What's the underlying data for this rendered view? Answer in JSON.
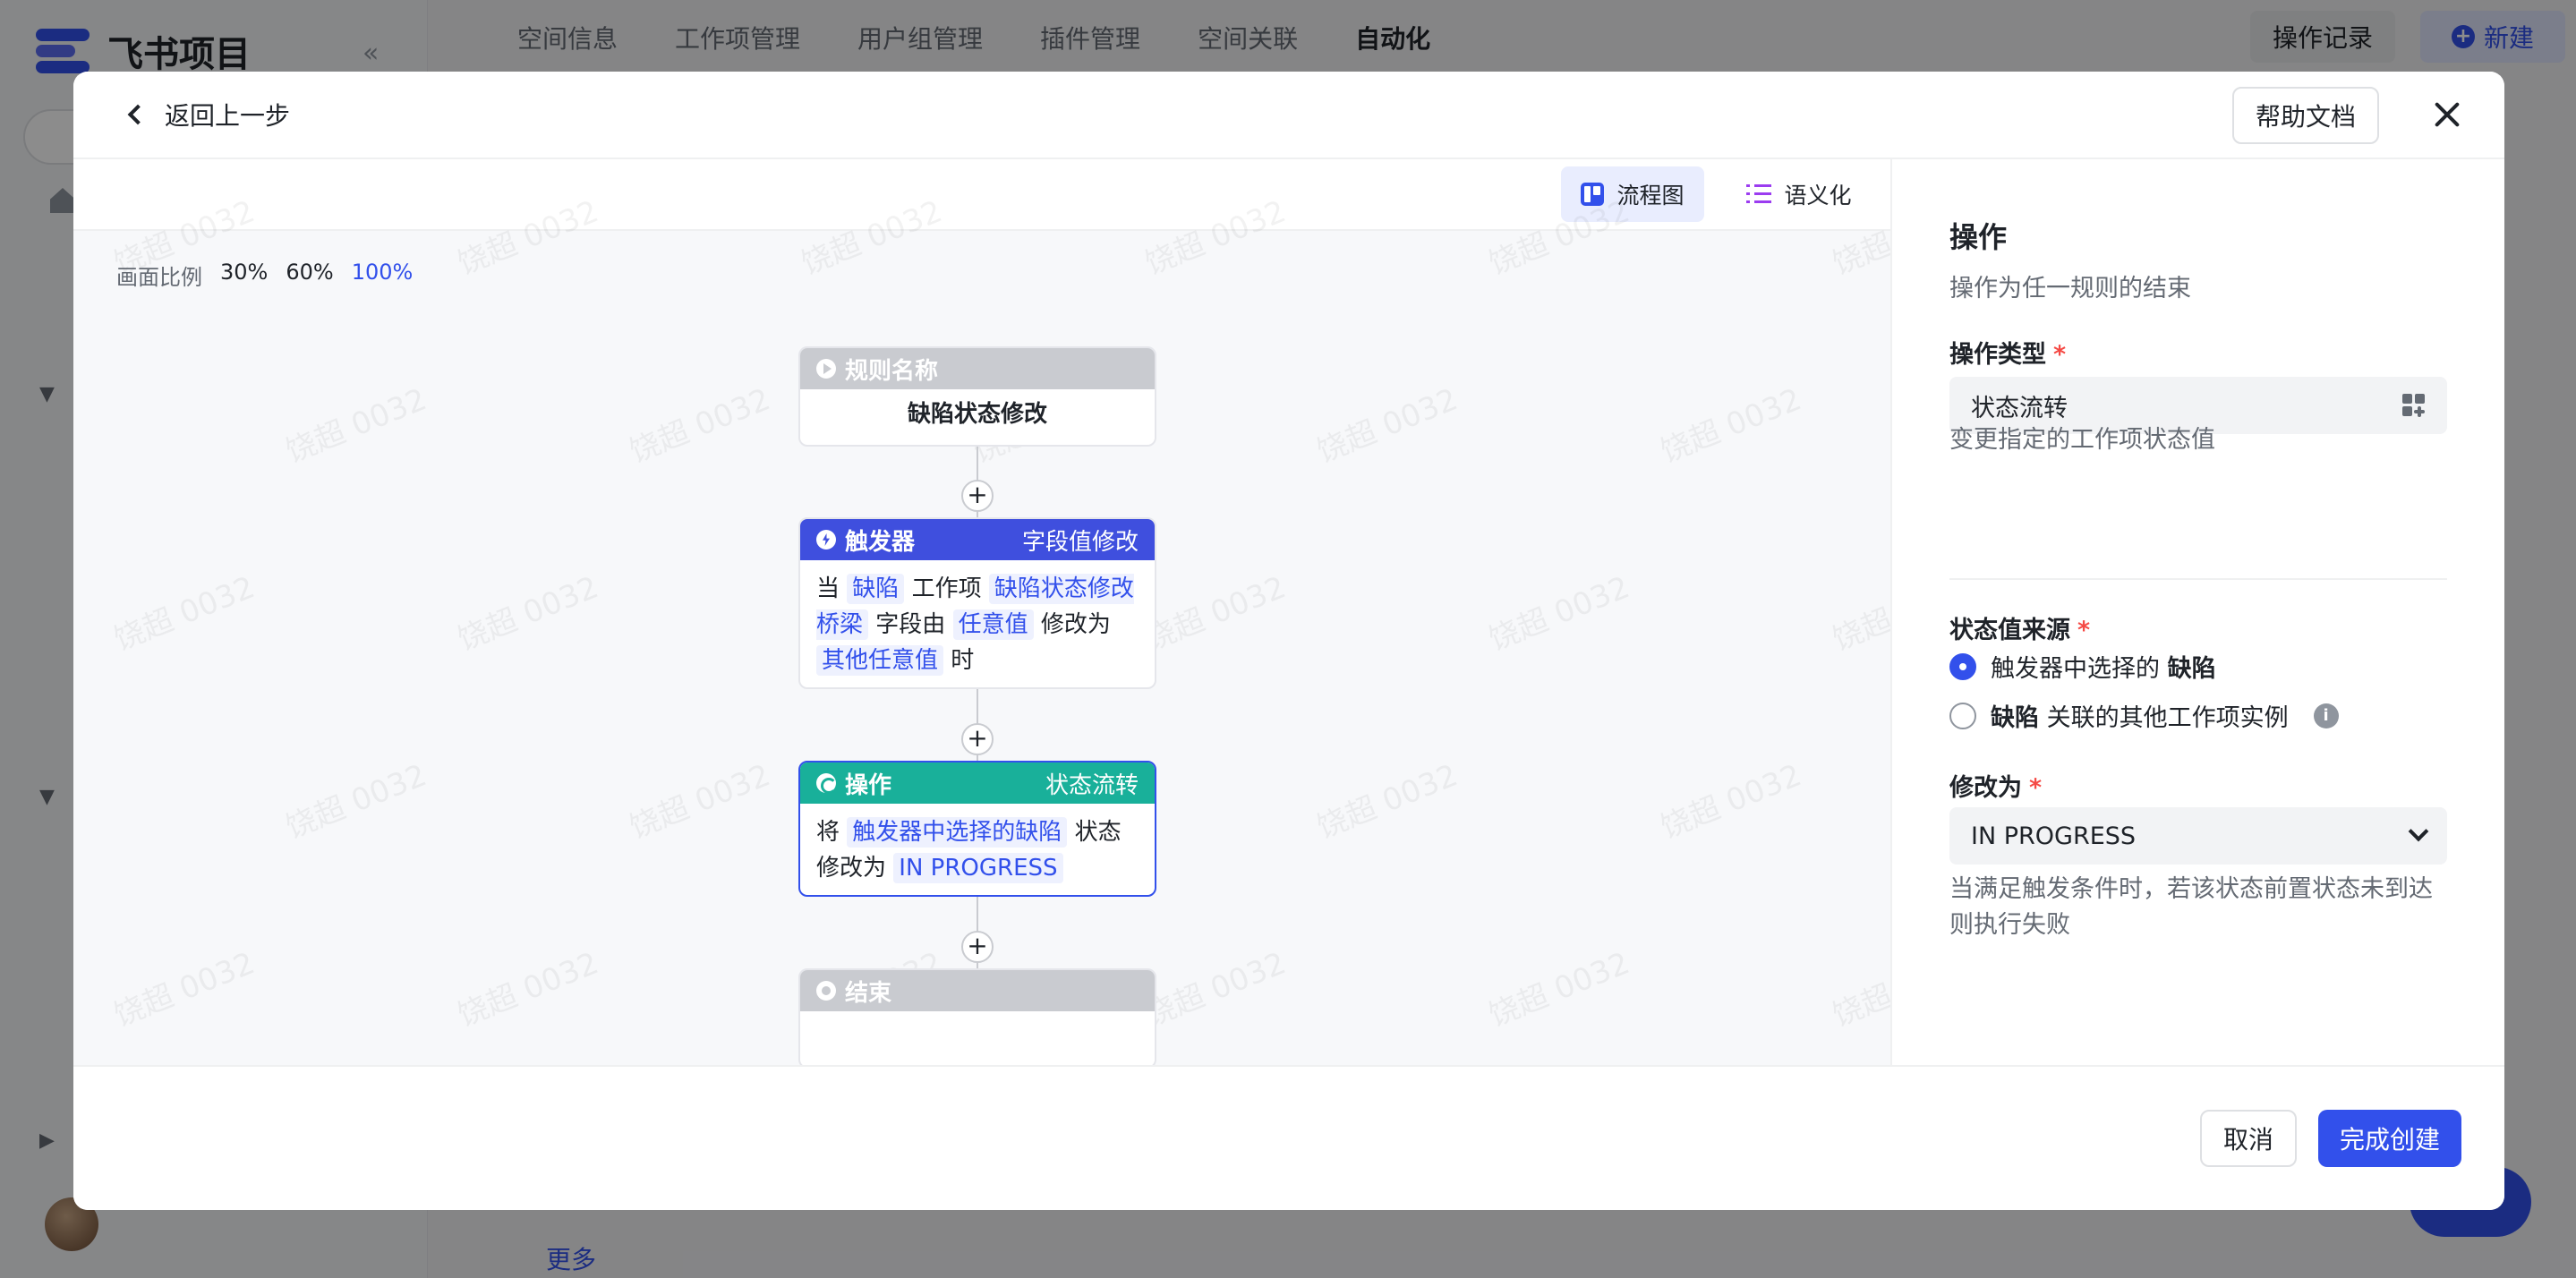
{
  "app": {
    "logo_text": "飞书项目"
  },
  "top_nav": {
    "items": [
      "空间信息",
      "工作项管理",
      "用户组管理",
      "插件管理",
      "空间关联",
      "自动化"
    ],
    "active_index": 5,
    "log_button": "操作记录",
    "new_button": "新建"
  },
  "sidebar": {
    "more_link": "更多"
  },
  "modal": {
    "back_label": "返回上一步",
    "help_button": "帮助文档",
    "view_toggle": {
      "flow": "流程图",
      "semantic": "语义化",
      "active": "flow"
    },
    "zoom": {
      "label": "画面比例",
      "options": [
        "30%",
        "60%",
        "100%"
      ],
      "active": "100%"
    },
    "watermark": "饶超 0032",
    "flow": {
      "rule_node": {
        "header": "规则名称",
        "title": "缺陷状态修改"
      },
      "trigger_node": {
        "header": "触发器",
        "header_right": "字段值修改",
        "t1": "当",
        "c1": "缺陷",
        "t2": "工作项",
        "c2": "缺陷状态修改桥梁",
        "t3": "字段由",
        "c3": "任意值",
        "t4": "修改为",
        "c4": "其他任意值",
        "t5": "时"
      },
      "action_node": {
        "header": "操作",
        "header_right": "状态流转",
        "t1": "将",
        "c1": "触发器中选择的缺陷",
        "t2": "状态修改为",
        "c2": "IN PROGRESS"
      },
      "end_node": {
        "header": "结束"
      }
    },
    "panel": {
      "title": "操作",
      "description": "操作为任一规则的结束",
      "op_type_label": "操作类型",
      "op_type_value": "状态流转",
      "op_type_hint": "变更指定的工作项状态值",
      "source_label": "状态值来源",
      "source_opt1_prefix": "触发器中选择的",
      "source_opt1_bold": "缺陷",
      "source_opt2_bold": "缺陷",
      "source_opt2_suffix": "关联的其他工作项实例",
      "selected_source": 1,
      "modify_label": "修改为",
      "modify_value": "IN PROGRESS",
      "modify_hint": "当满足触发条件时，若该状态前置状态未到达则执行失败"
    },
    "footer": {
      "cancel": "取消",
      "create": "完成创建"
    }
  },
  "colors": {
    "accent": "#3250eb",
    "trigger": "#3f4fde",
    "action": "#19b09a",
    "required": "#f54a45"
  }
}
